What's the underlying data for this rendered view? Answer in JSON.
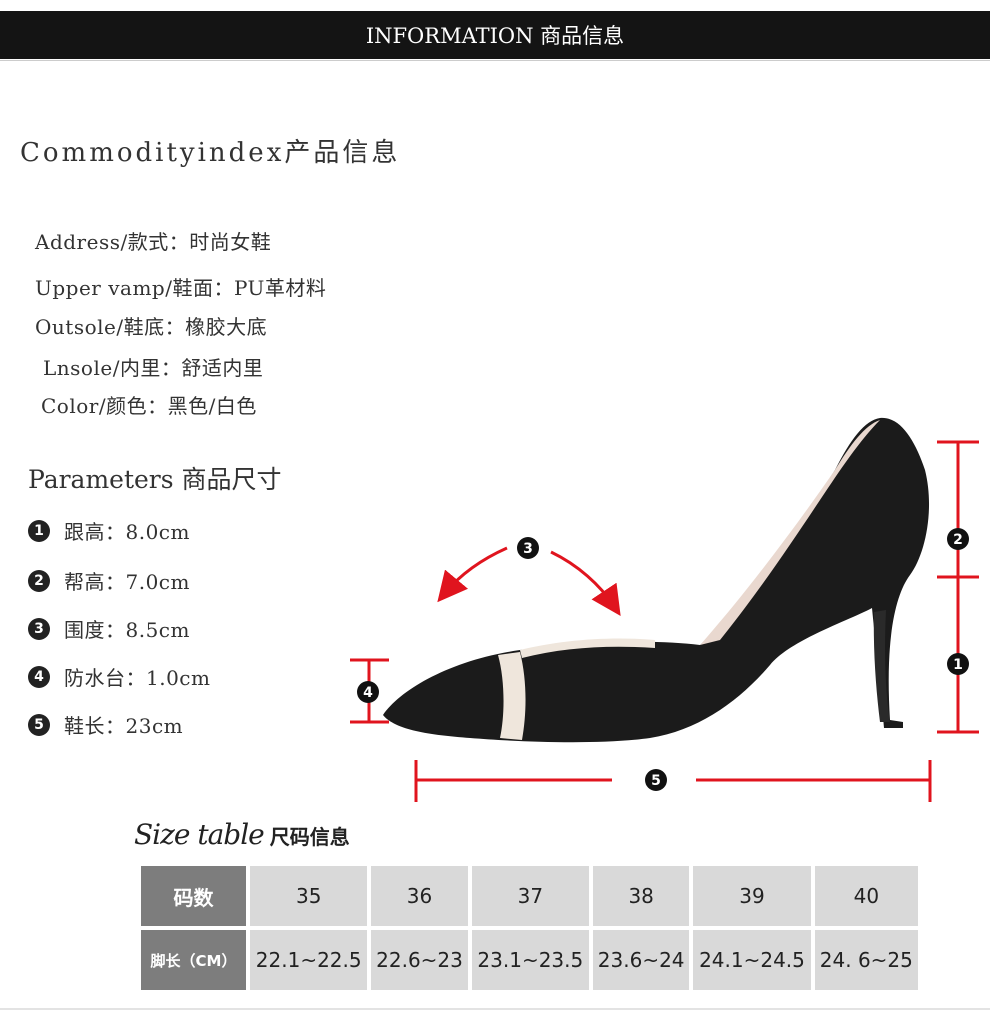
{
  "banner": {
    "title": "INFORMATION 商品信息"
  },
  "commodity": {
    "title": "Commodityindex产品信息",
    "specs": [
      "Address/款式：时尚女鞋",
      "Upper vamp/鞋面：PU革材料",
      "Outsole/鞋底：橡胶大底",
      "Lnsole/内里：舒适内里",
      "Color/颜色：黑色/白色"
    ]
  },
  "parameters": {
    "title": "Parameters 商品尺寸",
    "items": [
      {
        "num": "1",
        "text": "跟高：8.0cm"
      },
      {
        "num": "2",
        "text": "帮高：7.0cm"
      },
      {
        "num": "3",
        "text": "围度：8.5cm"
      },
      {
        "num": "4",
        "text": "防水台：1.0cm"
      },
      {
        "num": "5",
        "text": "鞋长：23cm"
      }
    ]
  },
  "diagram": {
    "markers": [
      "1",
      "2",
      "3",
      "4",
      "5"
    ],
    "accent_color": "#e0141e",
    "shoe_color": "#1a1a1a",
    "strap_color": "#efe6dc"
  },
  "size_table": {
    "title_en": "Size table",
    "title_cn": "尺码信息",
    "row1_label": "码数",
    "row2_label": "脚长（CM）",
    "sizes": [
      "35",
      "36",
      "37",
      "38",
      "39",
      "40"
    ],
    "lengths": [
      "22.1~22.5",
      "22.6~23",
      "23.1~23.5",
      "23.6~24",
      "24.1~24.5",
      "24. 6~25"
    ]
  }
}
